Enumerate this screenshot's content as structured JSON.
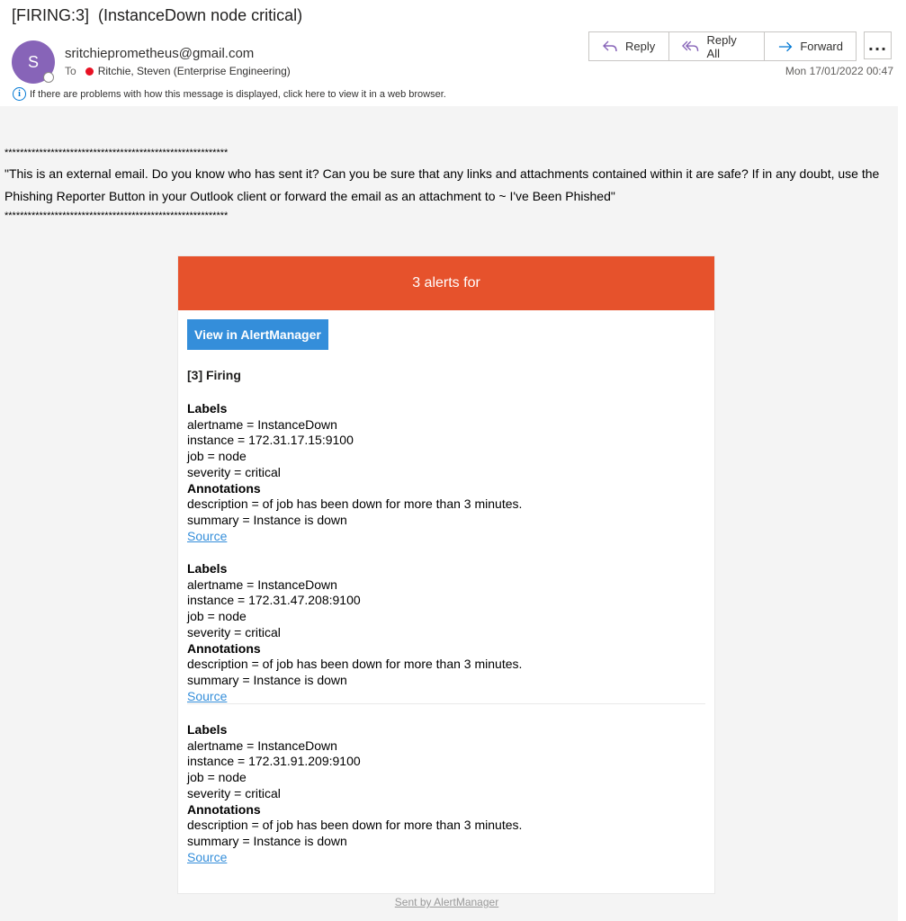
{
  "email": {
    "subject": "[FIRING:3]  (InstanceDown node critical)",
    "avatar_initial": "S",
    "sender": "sritchieprometheus@gmail.com",
    "to_label": "To",
    "recipient": "Ritchie, Steven (Enterprise Engineering)",
    "date": "Mon 17/01/2022 00:47",
    "info_text": "If there are problems with how this message is displayed, click here to view it in a web browser.",
    "actions": {
      "reply": "Reply",
      "reply_all": "Reply All",
      "forward": "Forward",
      "more": "..."
    }
  },
  "banner": {
    "stars": "**********************************************************",
    "text": "\"This is an external email. Do you know who has sent it? Can you be sure that any links and attachments contained within it are safe? If in any doubt, use the Phishing Reporter Button in your Outlook client or forward the email as an attachment to ~ I've Been Phished\""
  },
  "alert_card": {
    "header": "3 alerts for",
    "view_button": "View in AlertManager",
    "firing_title": "[3] Firing",
    "alerts": [
      {
        "labels_heading": "Labels",
        "alertname": "alertname = InstanceDown",
        "instance": "instance = 172.31.17.15:9100",
        "job": "job = node",
        "severity": "severity = critical",
        "annotations_heading": "Annotations",
        "description": "description = of job has been down for more than 3 minutes.",
        "summary": "summary = Instance is down",
        "source": "Source"
      },
      {
        "labels_heading": "Labels",
        "alertname": "alertname = InstanceDown",
        "instance": "instance = 172.31.47.208:9100",
        "job": "job = node",
        "severity": "severity = critical",
        "annotations_heading": "Annotations",
        "description": "description = of job has been down for more than 3 minutes.",
        "summary": "summary = Instance is down",
        "source": "Source"
      },
      {
        "labels_heading": "Labels",
        "alertname": "alertname = InstanceDown",
        "instance": "instance = 172.31.91.209:9100",
        "job": "job = node",
        "severity": "severity = critical",
        "annotations_heading": "Annotations",
        "description": "description = of job has been down for more than 3 minutes.",
        "summary": "summary = Instance is down",
        "source": "Source"
      }
    ],
    "footer": "Sent by AlertManager"
  },
  "colors": {
    "avatar": "#8764b8",
    "header": "#e6522c",
    "button": "#348eda",
    "presence_busy": "#e81123",
    "action_icon": "#8764b8",
    "forward_icon": "#0078d4"
  }
}
